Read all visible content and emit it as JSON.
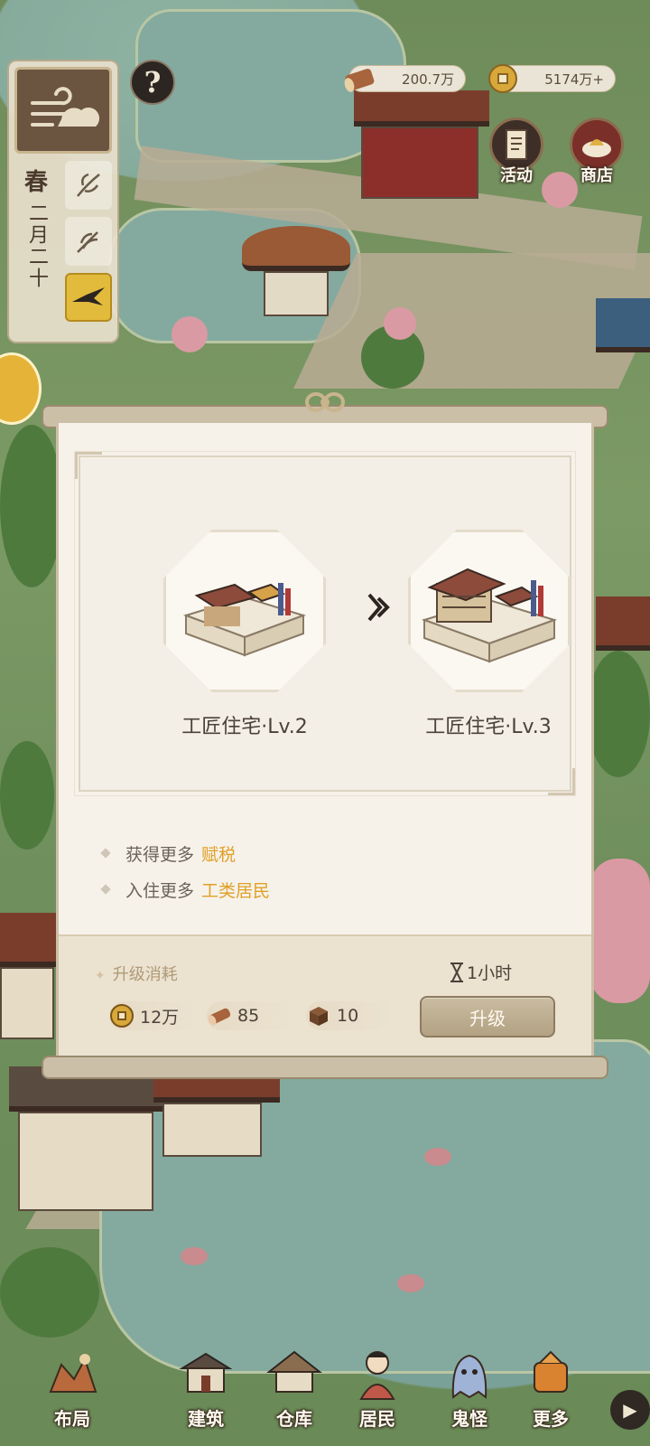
{
  "season": {
    "name": "春",
    "date": "二月二十"
  },
  "resources": {
    "wood": "200.7万",
    "money": "5174万+"
  },
  "corner_buttons": {
    "activity": "活动",
    "shop": "商店"
  },
  "help_label": "?",
  "upgrade_dialog": {
    "from_name": "工匠住宅·Lv.2",
    "to_name": "工匠住宅·Lv.3",
    "benefits": [
      {
        "text": "获得更多",
        "highlight": "赋税"
      },
      {
        "text": "入住更多",
        "highlight": "工类居民"
      }
    ],
    "cost_title": "升级消耗",
    "time": "1小时",
    "costs": {
      "coin": "12万",
      "wood": "85",
      "box": "10"
    },
    "upgrade_label": "升级"
  },
  "nav": {
    "layout": "布局",
    "build": "建筑",
    "warehouse": "仓库",
    "residents": "居民",
    "ghosts": "鬼怪",
    "more": "更多"
  },
  "colors": {
    "highlight": "#e0a027",
    "accent": "#b3a283"
  }
}
